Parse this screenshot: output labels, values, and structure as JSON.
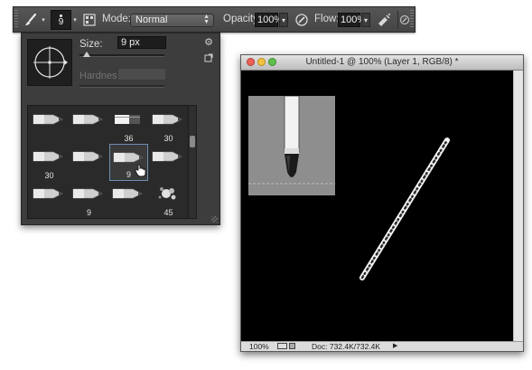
{
  "options_bar": {
    "brush_size": "9",
    "mode_label": "Mode:",
    "mode_value": "Normal",
    "opacity_label": "Opacity:",
    "opacity_value": "100%",
    "flow_label": "Flow:",
    "flow_value": "100%"
  },
  "brush_panel": {
    "size_label": "Size:",
    "size_value": "9 px",
    "hardness_label": "Hardness:",
    "hardness_value": "",
    "size_slider_fraction": 0.08,
    "presets": [
      {
        "number": "",
        "icon": "pencil-brush-icon",
        "selected": false
      },
      {
        "number": "",
        "icon": "pencil-brush-icon",
        "selected": false
      },
      {
        "number": "36",
        "icon": "marker-brush-icon",
        "selected": false
      },
      {
        "number": "30",
        "icon": "pencil-brush-icon",
        "selected": false
      },
      {
        "number": "30",
        "icon": "pencil-brush-icon",
        "selected": false
      },
      {
        "number": "",
        "icon": "pencil-brush-icon",
        "selected": false
      },
      {
        "number": "9",
        "icon": "pencil-brush-icon",
        "selected": true
      },
      {
        "number": "",
        "icon": "pencil-brush-icon",
        "selected": false
      },
      {
        "number": "",
        "icon": "pencil-brush-icon",
        "selected": false
      },
      {
        "number": "9",
        "icon": "pencil-brush-icon",
        "selected": false
      },
      {
        "number": "",
        "icon": "pencil-brush-icon",
        "selected": false
      },
      {
        "number": "45",
        "icon": "splatter-brush-icon",
        "selected": false
      }
    ]
  },
  "document": {
    "title": "Untitled-1 @ 100% (Layer 1, RGB/8) *",
    "zoom": "100%",
    "doc_size": "Doc: 732.4K/732.4K"
  },
  "colors": {
    "accent_selection": "#6f8fb3",
    "traffic_close": "#ee5f58",
    "traffic_minimize": "#f3c23e",
    "traffic_zoom": "#5fc14d"
  }
}
